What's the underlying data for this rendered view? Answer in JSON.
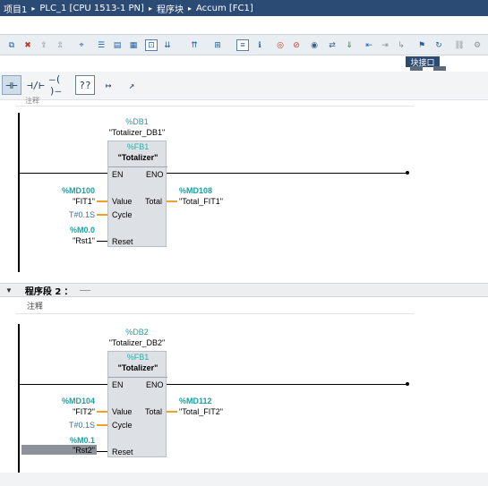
{
  "breadcrumb": {
    "items": [
      "项目1",
      "PLC_1 [CPU 1513-1 PN]",
      "程序块",
      "Accum [FC1]"
    ],
    "separator": "▸"
  },
  "toolbar": {
    "block_window_label": "块接口"
  },
  "ladder_toolbar": {
    "buttons": [
      "⊣⊢",
      "⊣/⊢",
      "–( )–",
      "??",
      "↦",
      "↗"
    ]
  },
  "network1": {
    "comment_fragment": "注释",
    "fb": {
      "instance_address": "%DB1",
      "instance_name": "\"Totalizer_DB1\"",
      "block_address": "%FB1",
      "block_name": "\"Totalizer\"",
      "pins": {
        "en": "EN",
        "eno": "ENO",
        "value": "Value",
        "total": "Total",
        "cycle": "Cycle",
        "reset": "Reset"
      },
      "inputs": {
        "value_addr": "%MD100",
        "value_sym": "\"FIT1\"",
        "cycle_const": "T#0.1S",
        "reset_addr": "%M0.0",
        "reset_sym": "\"Rst1\""
      },
      "outputs": {
        "total_addr": "%MD108",
        "total_sym": "\"Total_FIT1\""
      }
    }
  },
  "network2": {
    "title": "程序段 2",
    "colon": "：",
    "comment": "注释",
    "fb": {
      "instance_address": "%DB2",
      "instance_name": "\"Totalizer_DB2\"",
      "block_address": "%FB1",
      "block_name": "\"Totalizer\"",
      "pins": {
        "en": "EN",
        "eno": "ENO",
        "value": "Value",
        "total": "Total",
        "cycle": "Cycle",
        "reset": "Reset"
      },
      "inputs": {
        "value_addr": "%MD104",
        "value_sym": "\"FIT2\"",
        "cycle_const": "T#0.1S",
        "reset_addr": "%M0.1",
        "reset_sym": "\"Rst2\""
      },
      "outputs": {
        "total_addr": "%MD112",
        "total_sym": "\"Total_FIT2\""
      }
    }
  },
  "colors": {
    "breadcrumb_bg": "#2b4a74",
    "teal_address": "#1f9ea0",
    "orange_wire": "#f0a030",
    "fb_fill": "#dde1e6"
  }
}
